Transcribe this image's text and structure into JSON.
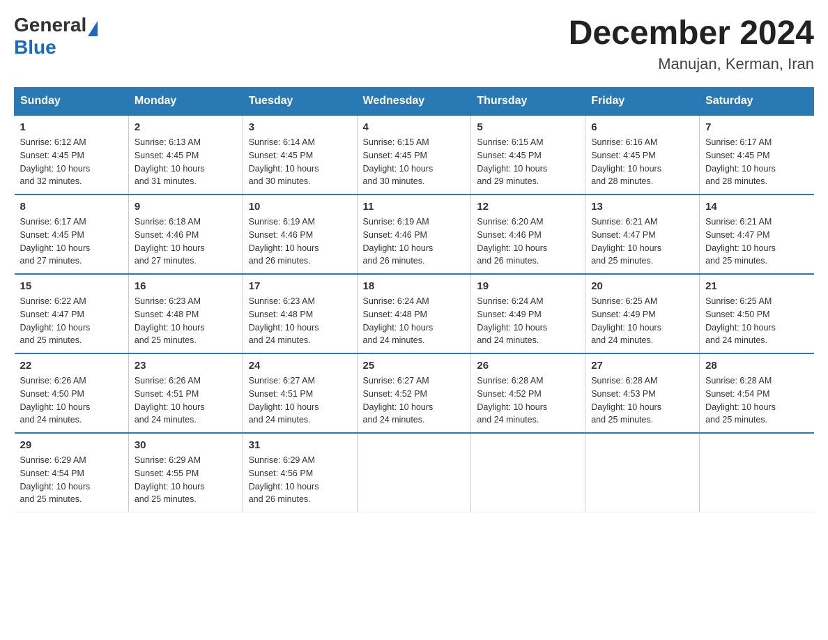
{
  "logo": {
    "general": "General",
    "blue": "Blue"
  },
  "title": "December 2024",
  "subtitle": "Manujan, Kerman, Iran",
  "headers": [
    "Sunday",
    "Monday",
    "Tuesday",
    "Wednesday",
    "Thursday",
    "Friday",
    "Saturday"
  ],
  "weeks": [
    [
      {
        "day": "1",
        "sunrise": "6:12 AM",
        "sunset": "4:45 PM",
        "daylight": "10 hours and 32 minutes."
      },
      {
        "day": "2",
        "sunrise": "6:13 AM",
        "sunset": "4:45 PM",
        "daylight": "10 hours and 31 minutes."
      },
      {
        "day": "3",
        "sunrise": "6:14 AM",
        "sunset": "4:45 PM",
        "daylight": "10 hours and 30 minutes."
      },
      {
        "day": "4",
        "sunrise": "6:15 AM",
        "sunset": "4:45 PM",
        "daylight": "10 hours and 30 minutes."
      },
      {
        "day": "5",
        "sunrise": "6:15 AM",
        "sunset": "4:45 PM",
        "daylight": "10 hours and 29 minutes."
      },
      {
        "day": "6",
        "sunrise": "6:16 AM",
        "sunset": "4:45 PM",
        "daylight": "10 hours and 28 minutes."
      },
      {
        "day": "7",
        "sunrise": "6:17 AM",
        "sunset": "4:45 PM",
        "daylight": "10 hours and 28 minutes."
      }
    ],
    [
      {
        "day": "8",
        "sunrise": "6:17 AM",
        "sunset": "4:45 PM",
        "daylight": "10 hours and 27 minutes."
      },
      {
        "day": "9",
        "sunrise": "6:18 AM",
        "sunset": "4:46 PM",
        "daylight": "10 hours and 27 minutes."
      },
      {
        "day": "10",
        "sunrise": "6:19 AM",
        "sunset": "4:46 PM",
        "daylight": "10 hours and 26 minutes."
      },
      {
        "day": "11",
        "sunrise": "6:19 AM",
        "sunset": "4:46 PM",
        "daylight": "10 hours and 26 minutes."
      },
      {
        "day": "12",
        "sunrise": "6:20 AM",
        "sunset": "4:46 PM",
        "daylight": "10 hours and 26 minutes."
      },
      {
        "day": "13",
        "sunrise": "6:21 AM",
        "sunset": "4:47 PM",
        "daylight": "10 hours and 25 minutes."
      },
      {
        "day": "14",
        "sunrise": "6:21 AM",
        "sunset": "4:47 PM",
        "daylight": "10 hours and 25 minutes."
      }
    ],
    [
      {
        "day": "15",
        "sunrise": "6:22 AM",
        "sunset": "4:47 PM",
        "daylight": "10 hours and 25 minutes."
      },
      {
        "day": "16",
        "sunrise": "6:23 AM",
        "sunset": "4:48 PM",
        "daylight": "10 hours and 25 minutes."
      },
      {
        "day": "17",
        "sunrise": "6:23 AM",
        "sunset": "4:48 PM",
        "daylight": "10 hours and 24 minutes."
      },
      {
        "day": "18",
        "sunrise": "6:24 AM",
        "sunset": "4:48 PM",
        "daylight": "10 hours and 24 minutes."
      },
      {
        "day": "19",
        "sunrise": "6:24 AM",
        "sunset": "4:49 PM",
        "daylight": "10 hours and 24 minutes."
      },
      {
        "day": "20",
        "sunrise": "6:25 AM",
        "sunset": "4:49 PM",
        "daylight": "10 hours and 24 minutes."
      },
      {
        "day": "21",
        "sunrise": "6:25 AM",
        "sunset": "4:50 PM",
        "daylight": "10 hours and 24 minutes."
      }
    ],
    [
      {
        "day": "22",
        "sunrise": "6:26 AM",
        "sunset": "4:50 PM",
        "daylight": "10 hours and 24 minutes."
      },
      {
        "day": "23",
        "sunrise": "6:26 AM",
        "sunset": "4:51 PM",
        "daylight": "10 hours and 24 minutes."
      },
      {
        "day": "24",
        "sunrise": "6:27 AM",
        "sunset": "4:51 PM",
        "daylight": "10 hours and 24 minutes."
      },
      {
        "day": "25",
        "sunrise": "6:27 AM",
        "sunset": "4:52 PM",
        "daylight": "10 hours and 24 minutes."
      },
      {
        "day": "26",
        "sunrise": "6:28 AM",
        "sunset": "4:52 PM",
        "daylight": "10 hours and 24 minutes."
      },
      {
        "day": "27",
        "sunrise": "6:28 AM",
        "sunset": "4:53 PM",
        "daylight": "10 hours and 25 minutes."
      },
      {
        "day": "28",
        "sunrise": "6:28 AM",
        "sunset": "4:54 PM",
        "daylight": "10 hours and 25 minutes."
      }
    ],
    [
      {
        "day": "29",
        "sunrise": "6:29 AM",
        "sunset": "4:54 PM",
        "daylight": "10 hours and 25 minutes."
      },
      {
        "day": "30",
        "sunrise": "6:29 AM",
        "sunset": "4:55 PM",
        "daylight": "10 hours and 25 minutes."
      },
      {
        "day": "31",
        "sunrise": "6:29 AM",
        "sunset": "4:56 PM",
        "daylight": "10 hours and 26 minutes."
      },
      null,
      null,
      null,
      null
    ]
  ],
  "labels": {
    "sunrise": "Sunrise:",
    "sunset": "Sunset:",
    "daylight": "Daylight:"
  }
}
